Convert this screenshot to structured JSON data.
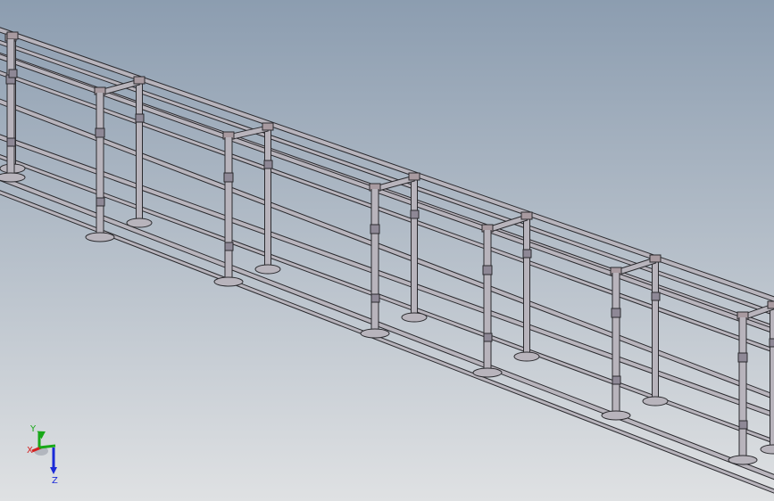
{
  "viewport": {
    "background_top": "#8c9db0",
    "background_bottom": "#dfe1e3"
  },
  "model": {
    "frame_color": "#b8b4bc",
    "frame_shadow": "#8e8896",
    "edge_color": "#2a2a2e",
    "bracket_color": "#a89aa0"
  },
  "triad": {
    "x_label": "X",
    "y_label": "Y",
    "z_label": "Z",
    "x_color": "#d42020",
    "y_color": "#18a818",
    "z_color": "#1a2ad8"
  }
}
